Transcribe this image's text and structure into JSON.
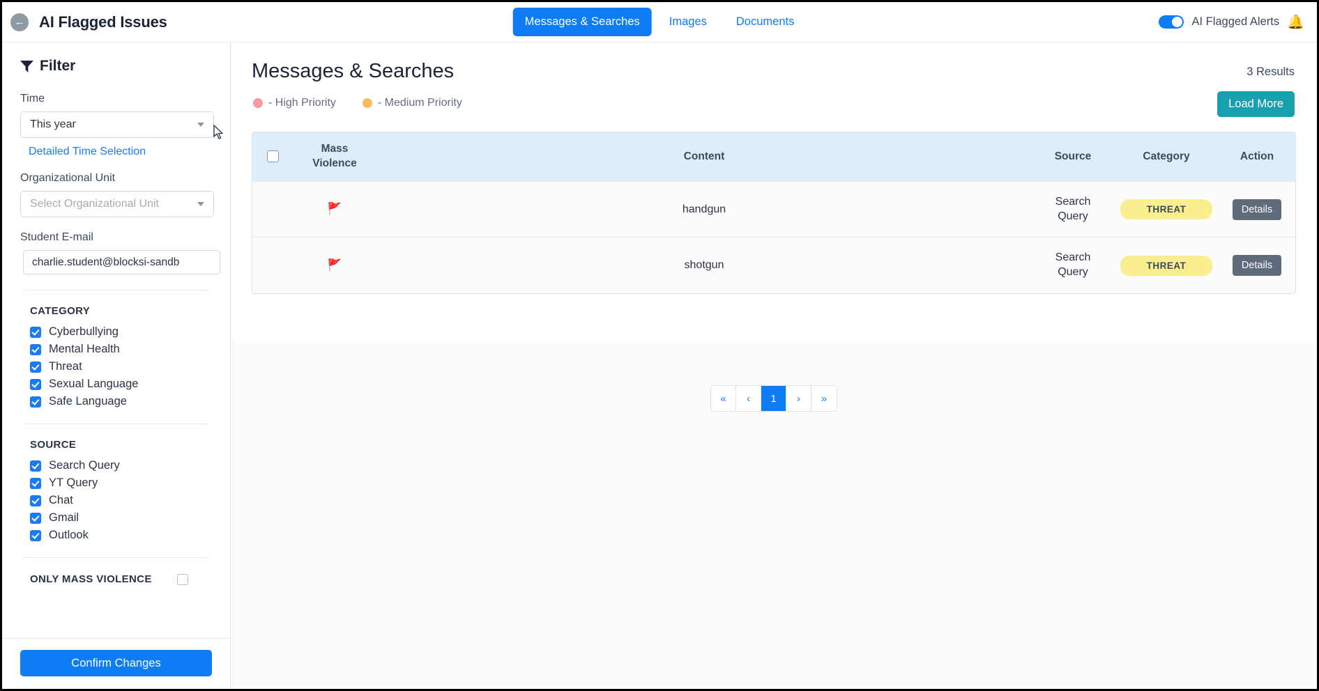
{
  "app": {
    "title": "AI Flagged Issues",
    "back_icon": "back-arrow-icon"
  },
  "tabs": [
    {
      "label": "Messages & Searches",
      "active": true
    },
    {
      "label": "Images",
      "active": false
    },
    {
      "label": "Documents",
      "active": false
    }
  ],
  "topbar_right": {
    "toggle_on": true,
    "alerts_label": "AI Flagged Alerts",
    "bell_icon": "bell-icon",
    "accent": "#0d7cf5",
    "bell_color": "#f7c948"
  },
  "sidebar": {
    "heading": "Filter",
    "filter_icon": "funnel-icon",
    "time_label": "Time",
    "time_value": "This year",
    "detailed_time_link": "Detailed Time Selection",
    "org_label": "Organizational Unit",
    "org_placeholder": "Select Organizational Unit",
    "email_label": "Student E-mail",
    "email_value": "charlie.student@blocksi-sandb",
    "category_title": "CATEGORY",
    "categories": [
      {
        "label": "Cyberbullying",
        "checked": true
      },
      {
        "label": "Mental Health",
        "checked": true
      },
      {
        "label": "Threat",
        "checked": true
      },
      {
        "label": "Sexual Language",
        "checked": true
      },
      {
        "label": "Safe Language",
        "checked": true
      }
    ],
    "source_title": "SOURCE",
    "sources": [
      {
        "label": "Search Query",
        "checked": true
      },
      {
        "label": "YT Query",
        "checked": true
      },
      {
        "label": "Chat",
        "checked": true
      },
      {
        "label": "Gmail",
        "checked": true
      },
      {
        "label": "Outlook",
        "checked": true
      }
    ],
    "mass_violence_title": "ONLY MASS VIOLENCE",
    "mass_violence_checked": false,
    "confirm_label": "Confirm Changes"
  },
  "main": {
    "page_title": "Messages & Searches",
    "results_count": "3 Results",
    "load_more_label": "Load More",
    "legend": [
      {
        "label": "- High Priority",
        "color": "#fb9a9a"
      },
      {
        "label": "- Medium Priority",
        "color": "#fbbd5c"
      }
    ],
    "table": {
      "headers": {
        "select": "",
        "mass_violence_line1": "Mass",
        "mass_violence_line2": "Violence",
        "content": "Content",
        "source": "Source",
        "category": "Category",
        "action": "Action"
      },
      "rows": [
        {
          "flag_icon": "red-flag-icon",
          "flag": "🚩",
          "content": "handgun",
          "source_line1": "Search",
          "source_line2": "Query",
          "category": "THREAT",
          "action_label": "Details"
        },
        {
          "flag_icon": "red-flag-icon",
          "flag": "🚩",
          "content": "shotgun",
          "source_line1": "Search",
          "source_line2": "Query",
          "category": "THREAT",
          "action_label": "Details"
        }
      ]
    },
    "pagination": {
      "first": "«",
      "prev": "‹",
      "current": "1",
      "next": "›",
      "last": "»"
    }
  }
}
